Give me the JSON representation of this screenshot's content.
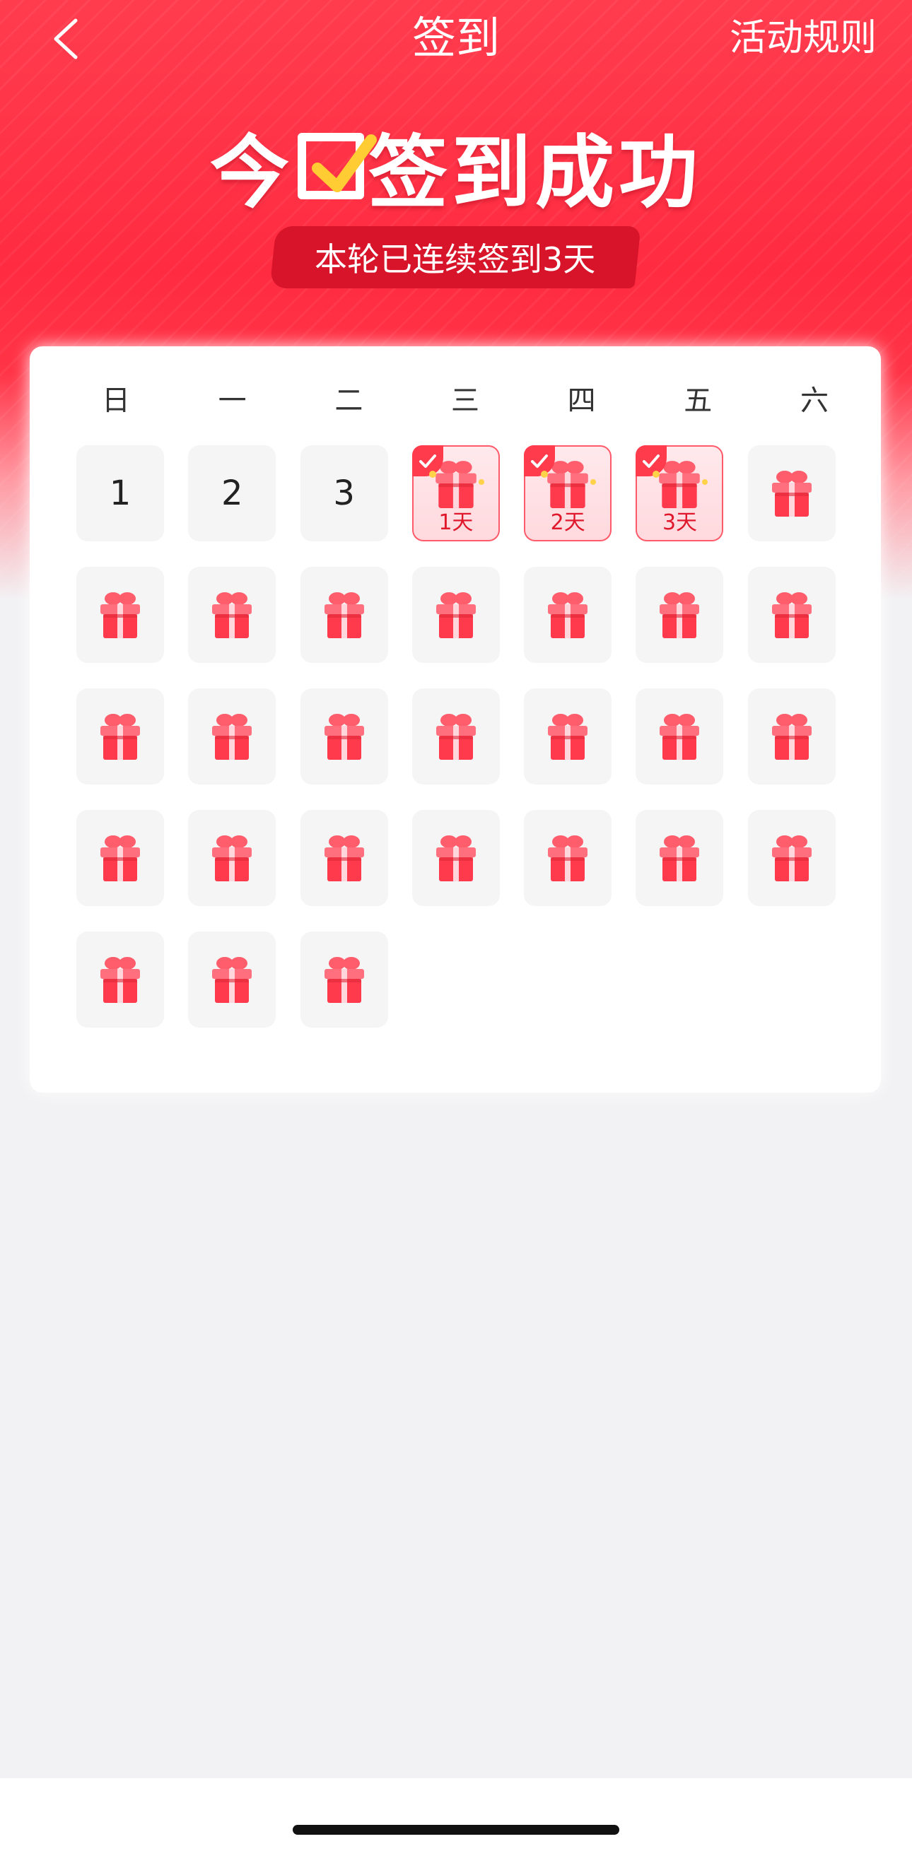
{
  "navbar": {
    "title": "签到",
    "rules_label": "活动规则"
  },
  "hero": {
    "success_part1": "今",
    "success_part2": "签到成功",
    "streak_text": "本轮已连续签到3天"
  },
  "calendar": {
    "weekdays": [
      "日",
      "一",
      "二",
      "三",
      "四",
      "五",
      "六"
    ],
    "past_days": [
      "1",
      "2",
      "3"
    ],
    "checked_days": [
      {
        "label": "1天"
      },
      {
        "label": "2天"
      },
      {
        "label": "3天"
      }
    ],
    "upcoming_reward_count": 25
  },
  "colors": {
    "brand_red": "#ff2b41",
    "pill_red": "#d8142a",
    "checked_bg": "#ffe1e5"
  }
}
